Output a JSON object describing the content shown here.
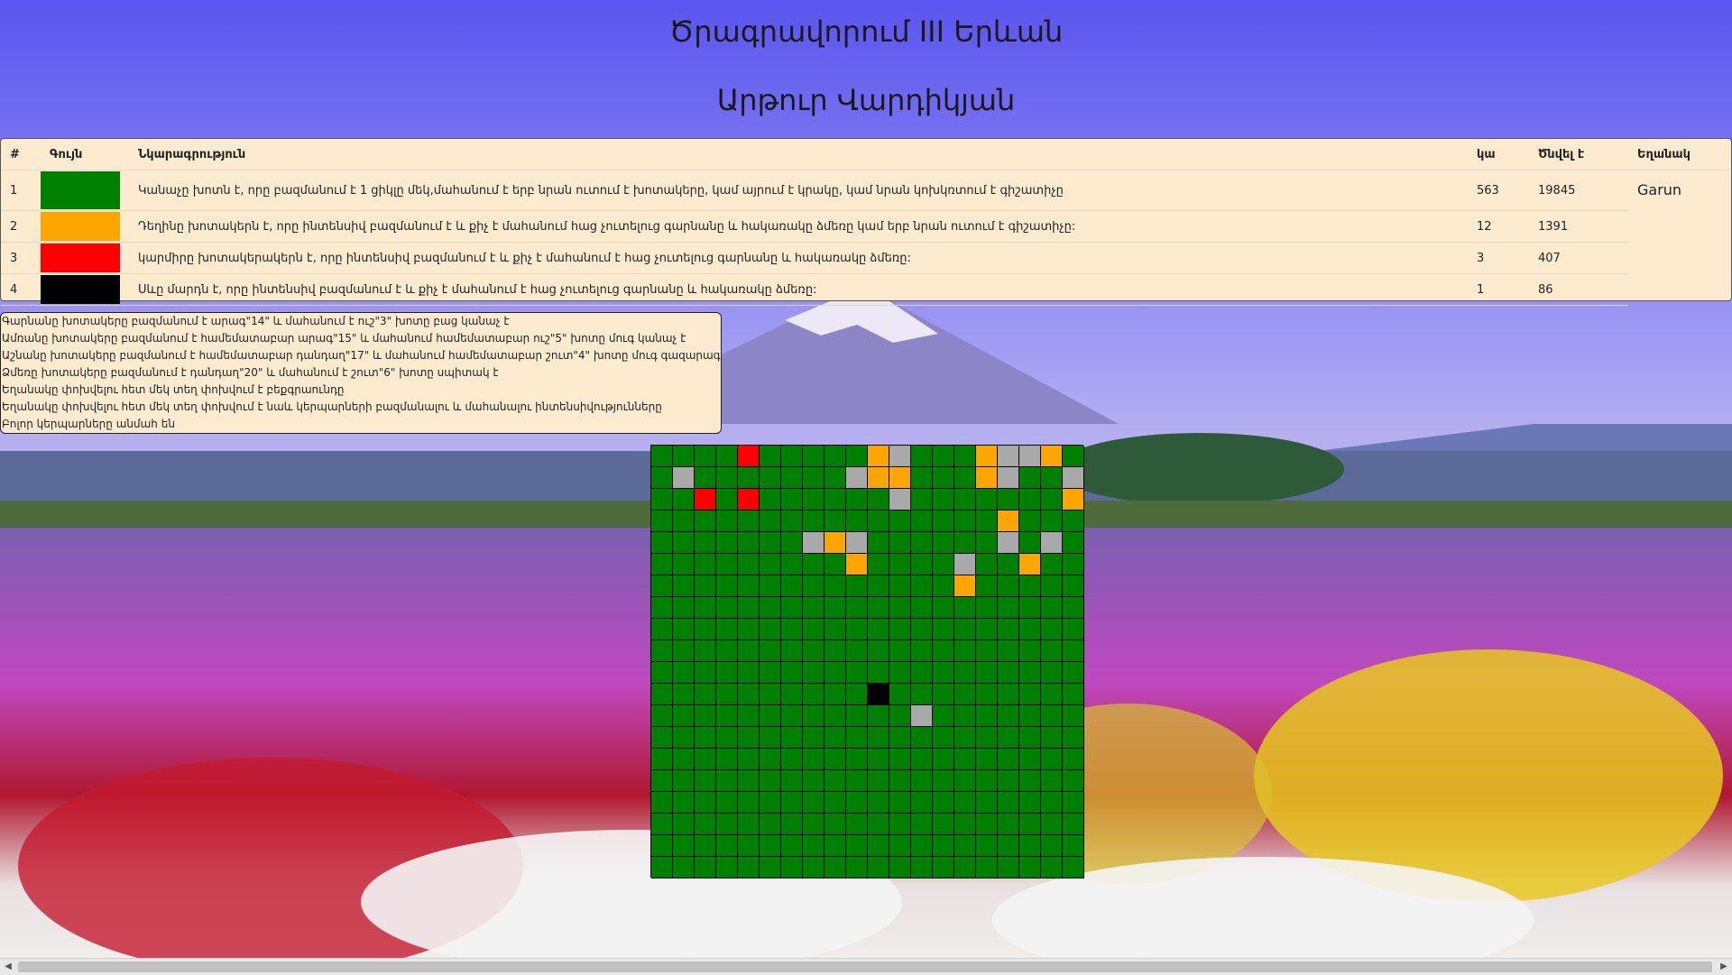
{
  "titles": {
    "school": "Ծրագրավորում III Երևան",
    "author": "Արթուր Վարդիկյան"
  },
  "table": {
    "headers": {
      "num": "#",
      "color": "Գույն",
      "desc": "Նկարագրություն",
      "count": "կա",
      "born": "Ծնվել է",
      "season": "Եղանակ"
    },
    "season_value": "Garun",
    "rows": [
      {
        "num": "1",
        "color": "#008000",
        "desc": "Կանաչը խոտն է, որը բազմանում է 1 ցիկլը մեկ,մահանում է երբ նրան ուտում է խոտակերը, կամ այրում է կրակը, կամ նրան կոխկռտում է գիշատիչը",
        "count": "563",
        "born": "19845"
      },
      {
        "num": "2",
        "color": "#ffa500",
        "desc": "Դեղինը խոտակերն է, որը ինտենսիվ բազմանում է և քիչ է մահանում հաց չուտելուց գարնանը և հակառակը ձմեռը կամ երբ նրան ուտում է գիշատիչը:",
        "count": "12",
        "born": "1391"
      },
      {
        "num": "3",
        "color": "#ff0000",
        "desc": "կարմիրը խոտակերակերն է, որը ինտենսիվ բազմանում է և քիչ է մահանում է հաց չուտելուց գարնանը և հակառակը ձմեռը:",
        "count": "3",
        "born": "407"
      },
      {
        "num": "4",
        "color": "#000000",
        "desc": "Սևը մարդն է, որը ինտենսիվ բազմանում է և քիչ է մահանում է հաց չուտելուց գարնանը և հակառակը ձմեռը:",
        "count": "1",
        "born": "86"
      }
    ]
  },
  "rules": [
    "Գարնանը խոտակերը բազմանում է արագ\"14\" և մահանում է ուշ\"3\" խոտը բաց կանաչ է",
    "Ամռանը խոտակերը բազմանում է համեմատաբար արագ\"15\" և մահանում համեմատաբար ուշ\"5\" խոտը մուգ կանաչ է",
    "Աշնանը խոտակերը բազմանում է համեմատաբար դանդաղ\"17\" և մահանում համեմատաբար շուտ\"4\" խոտը մուգ գազարագույն է",
    "Ձմեռը խոտակերը բազմանում է դանդաղ\"20\" և մահանում է շուտ\"6\" խոտը սպիտակ է",
    "Եղանակը փոխվելու հետ մեկ տեղ փոխվում է բեքգրաունդը",
    "Եղանակը փոխվելու հետ մեկ տեղ փոխվում է նաև կերպարների բազմանալու և մահանալու ինտենսիվությունները",
    "Բոլոր կերպարները անմահ են"
  ],
  "grid": {
    "size": 20,
    "colors": {
      "0": "#008000",
      "1": "#ffa500",
      "2": "#ff0000",
      "3": "#000000",
      "4": "#a9a9a9"
    },
    "cells": [
      [
        0,
        0,
        0,
        0,
        2,
        0,
        0,
        0,
        0,
        0,
        1,
        4,
        0,
        0,
        0,
        1,
        4,
        4,
        1,
        0
      ],
      [
        0,
        4,
        0,
        0,
        0,
        0,
        0,
        0,
        0,
        4,
        1,
        1,
        0,
        0,
        0,
        1,
        4,
        0,
        0,
        4
      ],
      [
        0,
        0,
        2,
        0,
        2,
        0,
        0,
        0,
        0,
        0,
        0,
        4,
        0,
        0,
        0,
        0,
        0,
        0,
        0,
        1
      ],
      [
        0,
        0,
        0,
        0,
        0,
        0,
        0,
        0,
        0,
        0,
        0,
        0,
        0,
        0,
        0,
        0,
        1,
        0,
        0,
        0
      ],
      [
        0,
        0,
        0,
        0,
        0,
        0,
        0,
        4,
        1,
        4,
        0,
        0,
        0,
        0,
        0,
        0,
        4,
        0,
        4,
        0
      ],
      [
        0,
        0,
        0,
        0,
        0,
        0,
        0,
        0,
        0,
        1,
        0,
        0,
        0,
        0,
        4,
        0,
        0,
        1,
        0,
        0
      ],
      [
        0,
        0,
        0,
        0,
        0,
        0,
        0,
        0,
        0,
        0,
        0,
        0,
        0,
        0,
        1,
        0,
        0,
        0,
        0,
        0
      ],
      [
        0,
        0,
        0,
        0,
        0,
        0,
        0,
        0,
        0,
        0,
        0,
        0,
        0,
        0,
        0,
        0,
        0,
        0,
        0,
        0
      ],
      [
        0,
        0,
        0,
        0,
        0,
        0,
        0,
        0,
        0,
        0,
        0,
        0,
        0,
        0,
        0,
        0,
        0,
        0,
        0,
        0
      ],
      [
        0,
        0,
        0,
        0,
        0,
        0,
        0,
        0,
        0,
        0,
        0,
        0,
        0,
        0,
        0,
        0,
        0,
        0,
        0,
        0
      ],
      [
        0,
        0,
        0,
        0,
        0,
        0,
        0,
        0,
        0,
        0,
        0,
        0,
        0,
        0,
        0,
        0,
        0,
        0,
        0,
        0
      ],
      [
        0,
        0,
        0,
        0,
        0,
        0,
        0,
        0,
        0,
        0,
        3,
        0,
        0,
        0,
        0,
        0,
        0,
        0,
        0,
        0
      ],
      [
        0,
        0,
        0,
        0,
        0,
        0,
        0,
        0,
        0,
        0,
        0,
        0,
        4,
        0,
        0,
        0,
        0,
        0,
        0,
        0
      ],
      [
        0,
        0,
        0,
        0,
        0,
        0,
        0,
        0,
        0,
        0,
        0,
        0,
        0,
        0,
        0,
        0,
        0,
        0,
        0,
        0
      ],
      [
        0,
        0,
        0,
        0,
        0,
        0,
        0,
        0,
        0,
        0,
        0,
        0,
        0,
        0,
        0,
        0,
        0,
        0,
        0,
        0
      ],
      [
        0,
        0,
        0,
        0,
        0,
        0,
        0,
        0,
        0,
        0,
        0,
        0,
        0,
        0,
        0,
        0,
        0,
        0,
        0,
        0
      ],
      [
        0,
        0,
        0,
        0,
        0,
        0,
        0,
        0,
        0,
        0,
        0,
        0,
        0,
        0,
        0,
        0,
        0,
        0,
        0,
        0
      ],
      [
        0,
        0,
        0,
        0,
        0,
        0,
        0,
        0,
        0,
        0,
        0,
        0,
        0,
        0,
        0,
        0,
        0,
        0,
        0,
        0
      ],
      [
        0,
        0,
        0,
        0,
        0,
        0,
        0,
        0,
        0,
        0,
        0,
        0,
        0,
        0,
        0,
        0,
        0,
        0,
        0,
        0
      ],
      [
        0,
        0,
        0,
        0,
        0,
        0,
        0,
        0,
        0,
        0,
        0,
        0,
        0,
        0,
        0,
        0,
        0,
        0,
        0,
        0
      ]
    ]
  },
  "scrollbar": {
    "left_arrow": "◀",
    "right_arrow": "▶"
  }
}
